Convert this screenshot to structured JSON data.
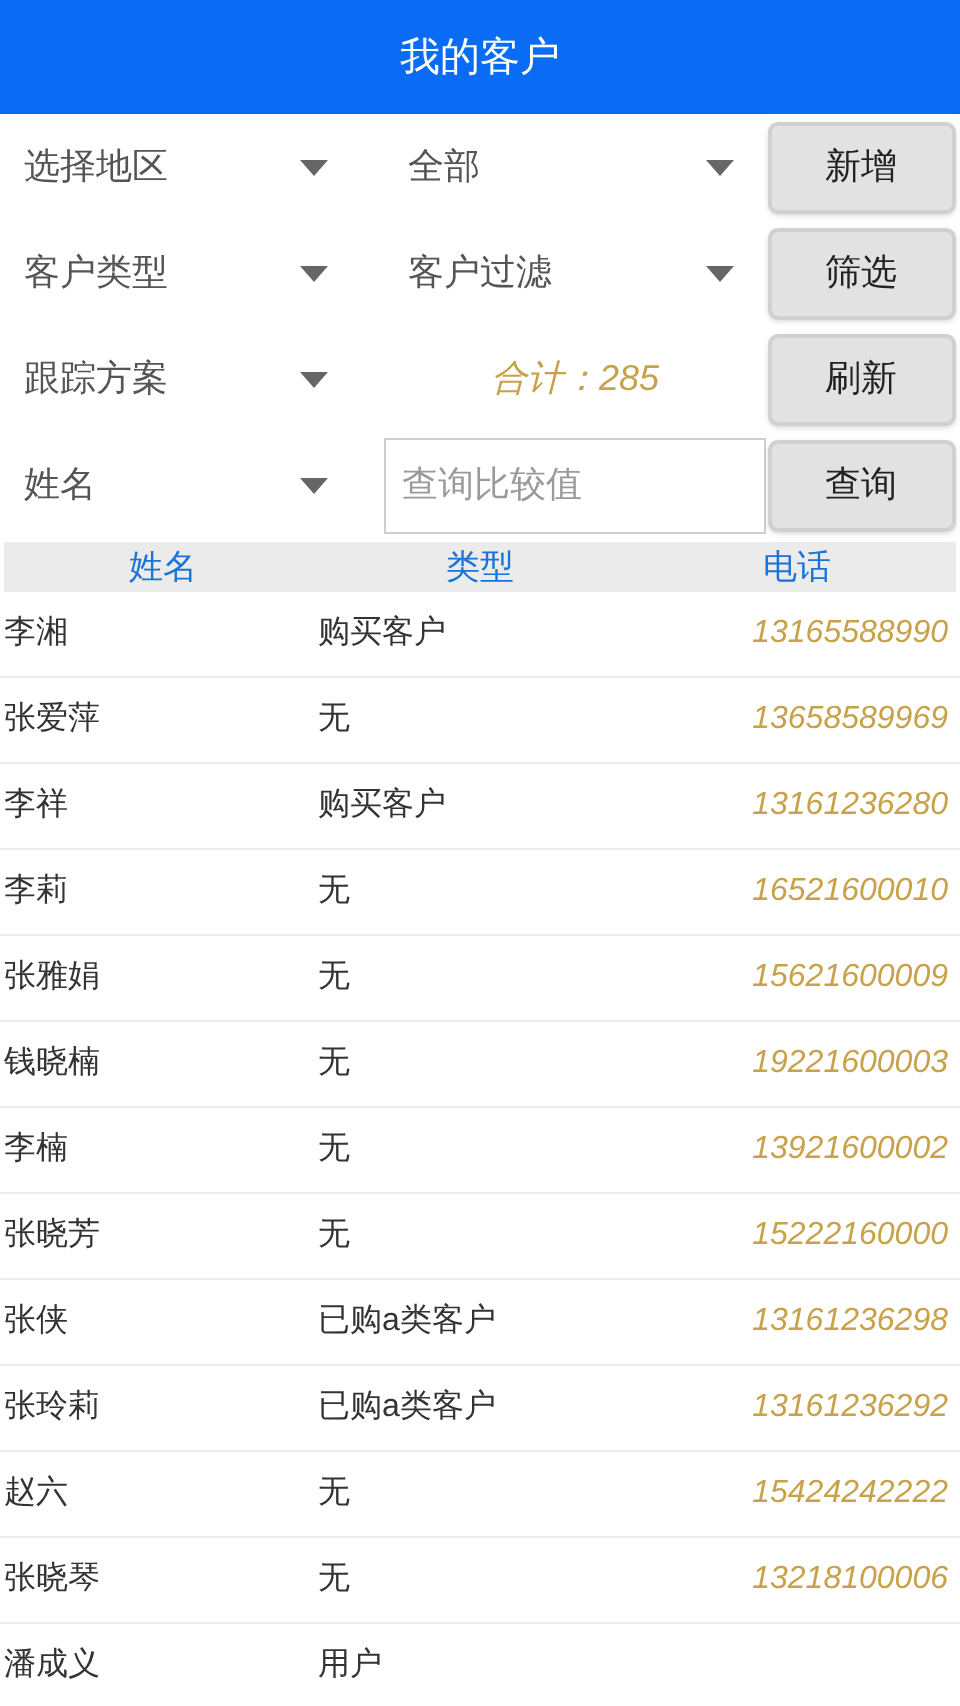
{
  "header": {
    "title": "我的客户"
  },
  "filter_rows": [
    {
      "left": {
        "kind": "dropdown",
        "value": "选择地区"
      },
      "middle": {
        "kind": "dropdown",
        "value": "全部"
      },
      "button": "新增"
    },
    {
      "left": {
        "kind": "dropdown",
        "value": "客户类型"
      },
      "middle": {
        "kind": "dropdown",
        "value": "客户过滤"
      },
      "button": "筛选"
    },
    {
      "left": {
        "kind": "dropdown",
        "value": "跟踪方案"
      },
      "middle": {
        "kind": "total",
        "value": "合计：285"
      },
      "button": "刷新"
    },
    {
      "left": {
        "kind": "dropdown",
        "value": "姓名"
      },
      "middle": {
        "kind": "input",
        "placeholder": "查询比较值"
      },
      "button": "查询"
    }
  ],
  "table": {
    "columns": [
      "姓名",
      "类型",
      "电话"
    ],
    "rows": [
      {
        "name": "李湘",
        "type": "购买客户",
        "phone": "13165588990"
      },
      {
        "name": "张爱萍",
        "type": "无",
        "phone": "13658589969"
      },
      {
        "name": "李祥",
        "type": "购买客户",
        "phone": "13161236280"
      },
      {
        "name": "李莉",
        "type": "无",
        "phone": "16521600010"
      },
      {
        "name": "张雅娟",
        "type": "无",
        "phone": "15621600009"
      },
      {
        "name": "钱晓楠",
        "type": "无",
        "phone": "19221600003"
      },
      {
        "name": "李楠",
        "type": "无",
        "phone": "13921600002"
      },
      {
        "name": "张晓芳",
        "type": "无",
        "phone": "15222160000"
      },
      {
        "name": "张侠",
        "type": "已购a类客户",
        "phone": "13161236298"
      },
      {
        "name": "张玲莉",
        "type": "已购a类客户",
        "phone": "13161236292"
      },
      {
        "name": "赵六",
        "type": "无",
        "phone": "15424242222"
      },
      {
        "name": "张晓琴",
        "type": "无",
        "phone": "13218100006"
      },
      {
        "name": "潘成义",
        "type": "用户"
      }
    ]
  }
}
